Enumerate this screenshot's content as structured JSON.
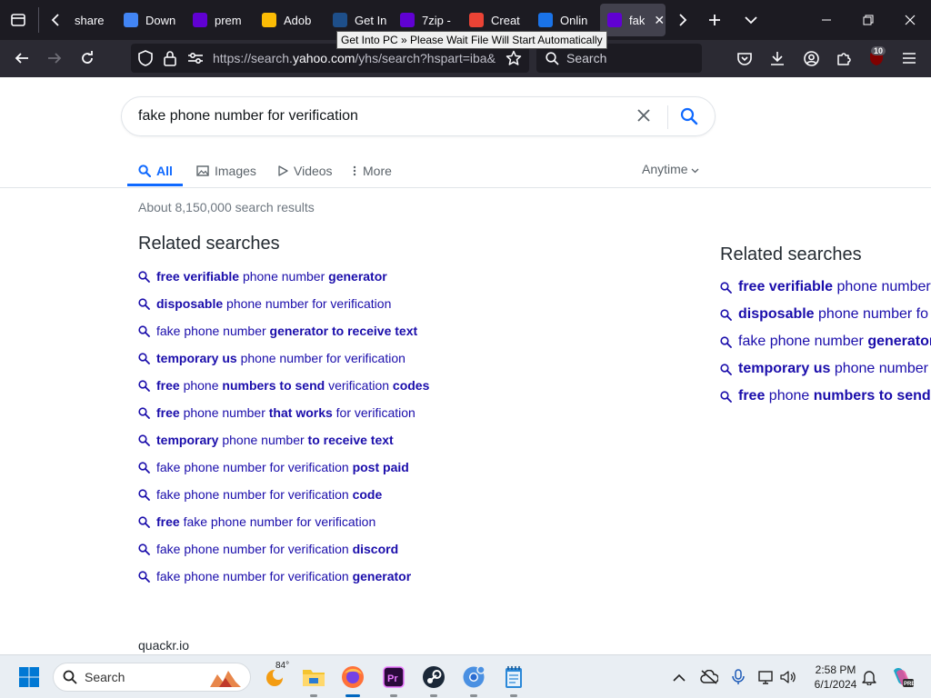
{
  "browser": {
    "tabs": [
      {
        "label": "share",
        "favicon": "share-favicon",
        "color": "#1c1b22"
      },
      {
        "label": "Down",
        "favicon": "chrome-favicon",
        "color": "#4285f4"
      },
      {
        "label": "prem",
        "favicon": "yahoo-favicon",
        "color": "#6001d2"
      },
      {
        "label": "Adob",
        "favicon": "google-favicon",
        "color": "#fbbc05"
      },
      {
        "label": "Get In",
        "favicon": "getintopc-favicon",
        "color": "#1e4f8a"
      },
      {
        "label": "7zip -",
        "favicon": "yahoo-favicon",
        "color": "#6001d2"
      },
      {
        "label": "Creat",
        "favicon": "google-favicon",
        "color": "#ea4335"
      },
      {
        "label": "Onlin",
        "favicon": "power-favicon",
        "color": "#1a73e8"
      },
      {
        "label": "fak",
        "favicon": "yahoo-favicon",
        "color": "#6001d2",
        "selected": true
      }
    ],
    "tooltip": "Get Into PC » Please Wait File Will Start Automatically",
    "url_prefix": "https://search.",
    "url_domain": "yahoo.com",
    "url_suffix": "/yhs/search?hspart=iba&",
    "search_placeholder": "Search",
    "extension_badge": "10"
  },
  "page": {
    "query": "fake phone number for verification",
    "tabs": [
      {
        "label": "All",
        "icon": "search-icon",
        "active": true
      },
      {
        "label": "Images",
        "icon": "image-icon"
      },
      {
        "label": "Videos",
        "icon": "play-icon"
      },
      {
        "label": "More",
        "icon": "more-vertical-icon"
      }
    ],
    "time_filter": "Anytime",
    "result_count": "About 8,150,000 search results",
    "related_heading": "Related searches",
    "related": [
      [
        {
          "t": "free verifiable",
          "b": true
        },
        {
          "t": " phone number "
        },
        {
          "t": "generator",
          "b": true
        }
      ],
      [
        {
          "t": "disposable",
          "b": true
        },
        {
          "t": " phone number for verification"
        }
      ],
      [
        {
          "t": "fake phone number "
        },
        {
          "t": "generator to receive text",
          "b": true
        }
      ],
      [
        {
          "t": "temporary us",
          "b": true
        },
        {
          "t": " phone number for verification"
        }
      ],
      [
        {
          "t": "free",
          "b": true
        },
        {
          "t": " phone "
        },
        {
          "t": "numbers to send",
          "b": true
        },
        {
          "t": " verification "
        },
        {
          "t": "codes",
          "b": true
        }
      ],
      [
        {
          "t": "free",
          "b": true
        },
        {
          "t": " phone number "
        },
        {
          "t": "that works",
          "b": true
        },
        {
          "t": " for verification"
        }
      ],
      [
        {
          "t": "temporary",
          "b": true
        },
        {
          "t": " phone number "
        },
        {
          "t": "to receive text",
          "b": true
        }
      ],
      [
        {
          "t": "fake phone number for verification "
        },
        {
          "t": "post paid",
          "b": true
        }
      ],
      [
        {
          "t": "fake phone number for verification "
        },
        {
          "t": "code",
          "b": true
        }
      ],
      [
        {
          "t": "free",
          "b": true
        },
        {
          "t": " fake phone number for verification"
        }
      ],
      [
        {
          "t": "fake phone number for verification "
        },
        {
          "t": "discord",
          "b": true
        }
      ],
      [
        {
          "t": "fake phone number for verification "
        },
        {
          "t": "generator",
          "b": true
        }
      ]
    ],
    "related_right": [
      [
        {
          "t": "free verifiable",
          "b": true
        },
        {
          "t": " phone number"
        }
      ],
      [
        {
          "t": "disposable",
          "b": true
        },
        {
          "t": " phone number fo"
        }
      ],
      [
        {
          "t": "fake phone number "
        },
        {
          "t": "generator",
          "b": true
        }
      ],
      [
        {
          "t": "temporary us",
          "b": true
        },
        {
          "t": " phone number "
        }
      ],
      [
        {
          "t": "free",
          "b": true
        },
        {
          "t": " phone "
        },
        {
          "t": "numbers to send",
          "b": true
        }
      ]
    ],
    "footer_site": "quackr.io"
  },
  "taskbar": {
    "search_label": "Search",
    "weather_temp": "84°",
    "time": "2:58 PM",
    "date": "6/1/2024",
    "apps": [
      "weather-icon",
      "file-explorer-icon",
      "firefox-icon",
      "premiere-icon",
      "steam-icon",
      "chrome-canary-icon",
      "notepad-icon"
    ]
  }
}
